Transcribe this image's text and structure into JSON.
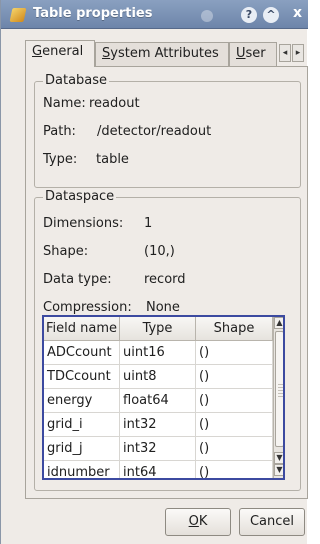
{
  "window": {
    "title": "Table properties",
    "title_buttons": {
      "help": "?",
      "shade": "^",
      "close": "x"
    }
  },
  "tabs": [
    {
      "label": "General",
      "mnemonic": "G",
      "rest": "eneral",
      "active": true
    },
    {
      "label": "System Attributes",
      "mnemonic": "S",
      "rest": "ystem Attributes",
      "active": false
    },
    {
      "label": "User",
      "mnemonic": "U",
      "rest": "ser",
      "active": false
    }
  ],
  "tab_scroll": {
    "left": "◂",
    "right": "▸"
  },
  "database": {
    "title": "Database",
    "name_label": "Name:",
    "name_value": "readout",
    "path_label": "Path:",
    "path_value": "/detector/readout",
    "type_label": "Type:",
    "type_value": "table"
  },
  "dataspace": {
    "title": "Dataspace",
    "dimensions_label": "Dimensions:",
    "dimensions_value": "1",
    "shape_label": "Shape:",
    "shape_value": "(10,)",
    "datatype_label": "Data type:",
    "datatype_value": "record",
    "compression_label": "Compression:",
    "compression_value": "None"
  },
  "fields_table": {
    "columns": [
      "Field name",
      "Type",
      "Shape"
    ],
    "rows": [
      [
        "ADCcount",
        "uint16",
        "()"
      ],
      [
        "TDCcount",
        "uint8",
        "()"
      ],
      [
        "energy",
        "float64",
        "()"
      ],
      [
        "grid_i",
        "int32",
        "()"
      ],
      [
        "grid_j",
        "int32",
        "()"
      ],
      [
        "idnumber",
        "int64",
        "()"
      ]
    ]
  },
  "buttons": {
    "ok": {
      "label": "OK",
      "mnemonic": "O",
      "rest": "K"
    },
    "cancel": {
      "label": "Cancel"
    }
  },
  "colors": {
    "titlebar": "#7b92b6",
    "dialog_bg": "#efebe7",
    "table_focus_border": "#3c4aa0"
  }
}
